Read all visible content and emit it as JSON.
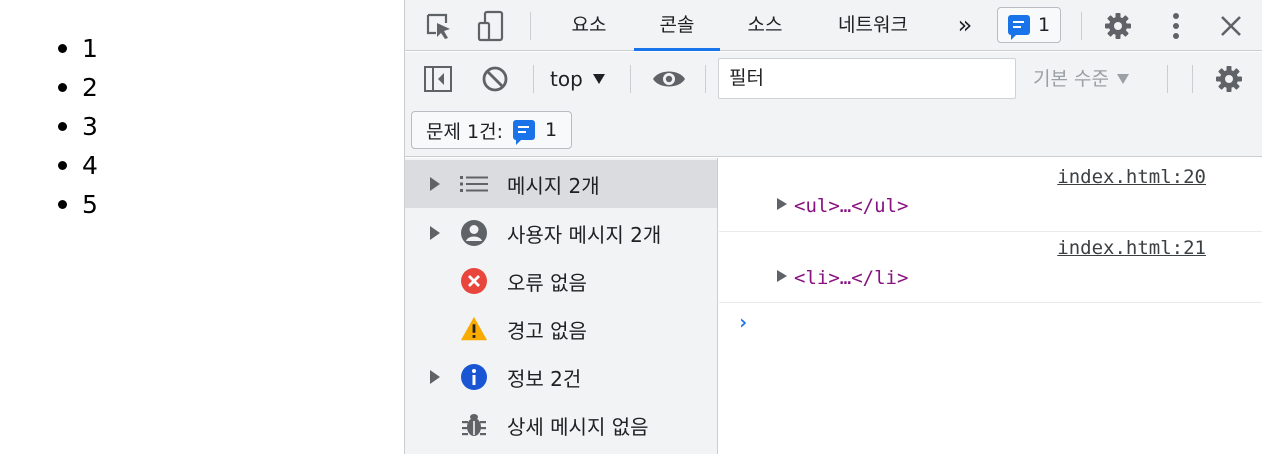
{
  "page": {
    "list_items": [
      "1",
      "2",
      "3",
      "4",
      "5"
    ]
  },
  "devtools": {
    "tabs": [
      {
        "label": "요소",
        "active": false
      },
      {
        "label": "콘솔",
        "active": true
      },
      {
        "label": "소스",
        "active": false
      },
      {
        "label": "네트워크",
        "active": false
      }
    ],
    "more_tabs_label": "»",
    "issues_badge_count": "1",
    "console_toolbar": {
      "context_label": "top",
      "filter_value": "필터",
      "levels_label": "기본 수준"
    },
    "issues_bar": {
      "label": "문제 1건:",
      "count": "1"
    },
    "sidebar": {
      "items": [
        {
          "label": "메시지 2개",
          "icon": "list-icon",
          "expandable": true,
          "selected": true
        },
        {
          "label": "사용자 메시지 2개",
          "icon": "user-icon",
          "expandable": true,
          "selected": false
        },
        {
          "label": "오류 없음",
          "icon": "error-icon",
          "expandable": false,
          "selected": false
        },
        {
          "label": "경고 없음",
          "icon": "warning-icon",
          "expandable": false,
          "selected": false
        },
        {
          "label": "정보 2건",
          "icon": "info-icon",
          "expandable": true,
          "selected": false
        },
        {
          "label": "상세 메시지 없음",
          "icon": "bug-icon",
          "expandable": false,
          "selected": false
        }
      ]
    },
    "console": {
      "messages": [
        {
          "source": "index.html:20",
          "content": "<ul>…</ul>"
        },
        {
          "source": "index.html:21",
          "content": "<li>…</li>"
        }
      ],
      "prompt": "›"
    }
  },
  "colors": {
    "accent": "#1a73e8",
    "toolbar_bg": "#f1f3f4",
    "tag_color": "#881280",
    "error": "#e8453c",
    "warning": "#f9ab00",
    "info": "#1a55d4"
  }
}
